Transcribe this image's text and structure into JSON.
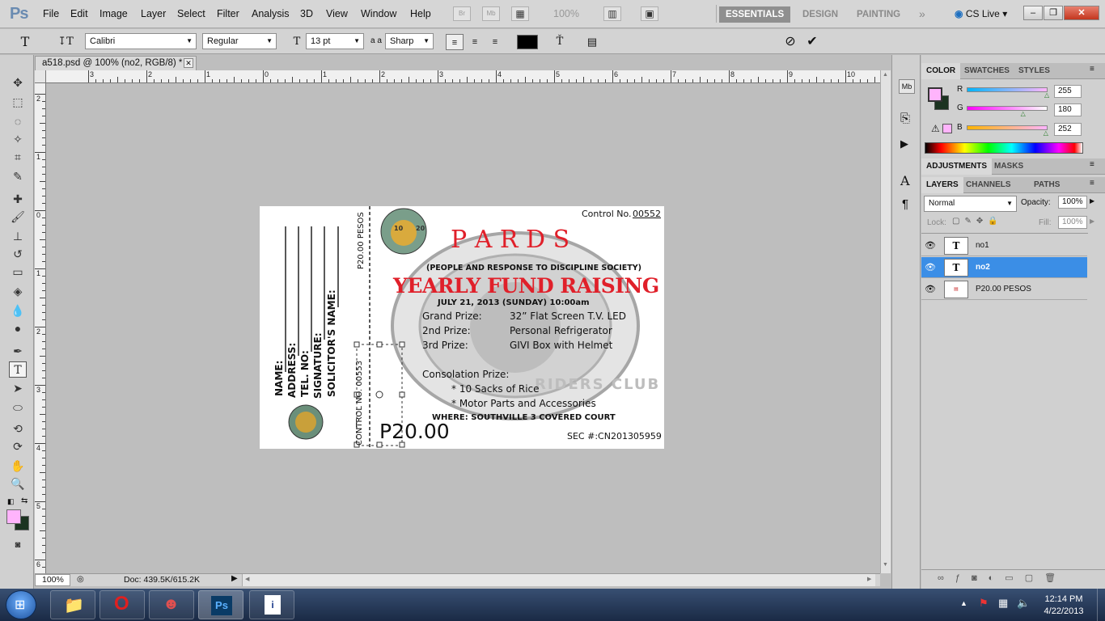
{
  "menubar": {
    "logo": "Ps",
    "items": [
      "File",
      "Edit",
      "Image",
      "Layer",
      "Select",
      "Filter",
      "Analysis",
      "3D",
      "View",
      "Window",
      "Help"
    ],
    "bridge": "Br",
    "minibridge": "Mb",
    "zoom": "100%",
    "workspaces": [
      "ESSENTIALS",
      "DESIGN",
      "PAINTING"
    ],
    "cs_live": "CS Live"
  },
  "options": {
    "font_family": "Calibri",
    "font_style": "Regular",
    "font_size": "13 pt",
    "aa_label": "a a",
    "antialias": "Sharp",
    "color": "#000000"
  },
  "document": {
    "tab_title": "a518.psd @ 100% (no2, RGB/8) *"
  },
  "ruler": {
    "h_numbers": [
      "3",
      "2",
      "1",
      "0",
      "1",
      "2",
      "3",
      "4",
      "5",
      "6",
      "7",
      "8",
      "9",
      "10"
    ],
    "v_numbers": [
      "2",
      "1",
      "0",
      "1",
      "2",
      "3",
      "4",
      "5",
      "6"
    ]
  },
  "ticket": {
    "control_label": "Control No.",
    "control_no": "00552",
    "title": "P A R D S",
    "subtitle": "(PEOPLE AND RESPONSE TO DISCIPLINE SOCIETY)",
    "headline": "YEARLY FUND RAISING",
    "date": "JULY 21, 2013 (SUNDAY) 10:00am",
    "prizes": [
      {
        "label": "Grand Prize:",
        "value": "32” Flat Screen T.V. LED"
      },
      {
        "label": "2nd Prize:",
        "value": "Personal Refrigerator"
      },
      {
        "label": "3rd Prize:",
        "value": "GIVI Box with Helmet"
      }
    ],
    "consolation_label": "Consolation Prize:",
    "consolation_items": [
      "* 10 Sacks of Rice",
      "* Motor Parts and Accessories"
    ],
    "where": "WHERE: SOUTHVILLE 3 COVERED COURT",
    "sec": "SEC #:CN201305959",
    "price": "P20.00",
    "stub_price": "P20.00 PESOS",
    "stub_control": "CONTROL NO. 00553",
    "stub_fields": [
      "NAME:",
      "ADDRESS:",
      "TEL. NO:",
      "SIGNATURE:",
      "SOLICITOR'S NAME:"
    ],
    "seal_year_left": "20",
    "seal_year_right": "10",
    "watermark_text": "RIDERS CLUB"
  },
  "statusbar": {
    "zoom": "100%",
    "doc": "Doc: 439.5K/615.2K"
  },
  "color_panel": {
    "tabs": [
      "COLOR",
      "SWATCHES",
      "STYLES"
    ],
    "channels": [
      {
        "name": "R",
        "value": "255",
        "level": 1.0
      },
      {
        "name": "G",
        "value": "180",
        "level": 0.706
      },
      {
        "name": "B",
        "value": "252",
        "level": 0.988
      }
    ],
    "foreground": "#ffb4fc",
    "background": "#1b3320"
  },
  "adjustments_panel": {
    "tabs": [
      "ADJUSTMENTS",
      "MASKS"
    ]
  },
  "layers_panel": {
    "tabs": [
      "LAYERS",
      "CHANNELS",
      "PATHS"
    ],
    "blend_mode": "Normal",
    "opacity_label": "Opacity:",
    "opacity": "100%",
    "lock_label": "Lock:",
    "fill_label": "Fill:",
    "fill": "100%",
    "layers": [
      {
        "name": "no1",
        "type": "text",
        "selected": false
      },
      {
        "name": "no2",
        "type": "text",
        "selected": true
      },
      {
        "name": "P20.00 PESOS",
        "type": "image",
        "selected": false
      }
    ]
  },
  "taskbar": {
    "time": "12:14 PM",
    "date": "4/22/2013"
  },
  "colors": {
    "accent_red": "#e0202a",
    "selection_blue": "#3b8ee6"
  }
}
